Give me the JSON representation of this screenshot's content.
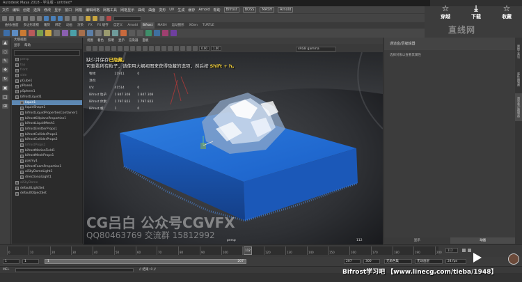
{
  "window": {
    "title": "Autodesk Maya 2018 - 学生版 - untitled*"
  },
  "menubar": {
    "items": [
      "文件",
      "编辑",
      "创建",
      "选择",
      "修改",
      "显示",
      "窗口",
      "网格",
      "编辑网格",
      "网格工具",
      "网格显示",
      "曲线",
      "曲面",
      "变形",
      "UV",
      "生成",
      "缓存",
      "Arnold",
      "帮助"
    ],
    "badges": [
      "Bifrost",
      "BOSS",
      "MASH",
      "Arnold"
    ]
  },
  "shelf": {
    "tabs": [
      "曲线/曲面",
      "多边形建模",
      "雕刻",
      "绑定",
      "动画",
      "渲染",
      "FX",
      "FX 缓存",
      "自定义",
      "Arnold",
      "Bifrost",
      "MASH",
      "运动图形",
      "XGen",
      "TURTLE"
    ],
    "active_tab": "Bifrost"
  },
  "outliner": {
    "title": "大纲视图",
    "menu": [
      "显示",
      "帮助"
    ],
    "items": [
      {
        "label": "persp",
        "state": "dim"
      },
      {
        "label": "top",
        "state": "dim"
      },
      {
        "label": "front",
        "state": "dim"
      },
      {
        "label": "side",
        "state": "dim"
      },
      {
        "label": "pCube1",
        "state": "normal"
      },
      {
        "label": "pPlane1",
        "state": "normal"
      },
      {
        "label": "pSphere1",
        "state": "normal"
      },
      {
        "label": "bifrostLiquid1",
        "state": "normal"
      },
      {
        "label": "liquid1",
        "state": "selected"
      },
      {
        "label": "liquidShape1",
        "state": "normal"
      },
      {
        "label": "bifrostLiquidPropertiesContainer1",
        "state": "normal"
      },
      {
        "label": "bifrostKillplaneProperties1",
        "state": "normal"
      },
      {
        "label": "bifrostLiquidMesh1",
        "state": "normal"
      },
      {
        "label": "bifrostEmitterProps1",
        "state": "normal"
      },
      {
        "label": "bifrostColliderProps1",
        "state": "normal"
      },
      {
        "label": "bifrostColliderProps2",
        "state": "normal"
      },
      {
        "label": "bifrostProps1",
        "state": "dim"
      },
      {
        "label": "bifrostMotionField1",
        "state": "normal"
      },
      {
        "label": "bifrostMeshProps1",
        "state": "normal"
      },
      {
        "label": "pasmy1",
        "state": "normal"
      },
      {
        "label": "bifrostFoamProperties1",
        "state": "normal"
      },
      {
        "label": "aiSkyDomeLight1",
        "state": "normal"
      },
      {
        "label": "directionalLight1",
        "state": "normal"
      },
      {
        "label": "aiSkyDome",
        "state": "dim"
      },
      {
        "label": "defaultLightSet",
        "state": "normal"
      },
      {
        "label": "defaultObjectSet",
        "state": "normal"
      }
    ]
  },
  "viewport": {
    "menu": [
      "视图",
      "着色",
      "照明",
      "显示",
      "渲染器",
      "面板"
    ],
    "colorspace": "sRGB gamma",
    "field_a": "0.00",
    "field_b": "1.00",
    "camera_label": "persp",
    "frame_label": "112",
    "hud": [
      {
        "k": "物体:",
        "a": "21911",
        "b": "0"
      },
      {
        "k": "顶点:",
        "a": "",
        "b": ""
      },
      {
        "k": "UV:",
        "a": "41514",
        "b": "0"
      },
      {
        "k": "Bifrost 粒子:",
        "a": "1 847 308",
        "b": "1 847 308"
      },
      {
        "k": "Bifrost 体素:",
        "a": "1 797 823",
        "b": "1 797 823"
      },
      {
        "k": "Bifrost 帧:",
        "a": "1",
        "b": "0"
      }
    ]
  },
  "subtitle": {
    "line1_pre": "缺少并保存",
    "line1_hl": "已隐藏。",
    "line2_pre": "可查看所有粒子，请使用大纲视图来获得隐藏的选项，然后按 ",
    "line2_hl": "Shift + h。"
  },
  "watermark": {
    "cg": "CG吕白 公众号CGVFX",
    "qq": "QQ80463769 交流群 15812992",
    "site": "直线网"
  },
  "rightpanel": {
    "header": "通道盒/层编辑器",
    "body": "选择对象以查看其属性",
    "bottom_tabs": [
      "显示",
      "动画"
    ],
    "active_bottom": "动画",
    "side_tabs": [
      "建模工具包",
      "属性编辑器",
      "通道盒/层编辑器"
    ]
  },
  "timeline": {
    "ticks": [
      "0",
      "10",
      "20",
      "30",
      "40",
      "50",
      "60",
      "70",
      "80",
      "90",
      "100",
      "110",
      "120",
      "130",
      "140",
      "150",
      "160",
      "170",
      "180",
      "190",
      "200"
    ],
    "current_frame": "112",
    "current_field": "112"
  },
  "range": {
    "start": "1",
    "inner_start": "1",
    "slider_start": "1",
    "slider_end": "207",
    "inner_end": "207",
    "end": "300",
    "no_char": "无角色集",
    "no_anim": "无动画层",
    "fps": "24 fps"
  },
  "cmdline": {
    "lang": "MEL",
    "hint": "// 结果: 0 //"
  },
  "overlay": {
    "buttons": [
      {
        "label": "穿越",
        "icon": "☆"
      },
      {
        "label": "下载",
        "icon": "⤓"
      },
      {
        "label": "收藏",
        "icon": "☆"
      }
    ]
  },
  "branding": "Bifrost学习吧 【www.linecg.com/tieba/1948】"
}
